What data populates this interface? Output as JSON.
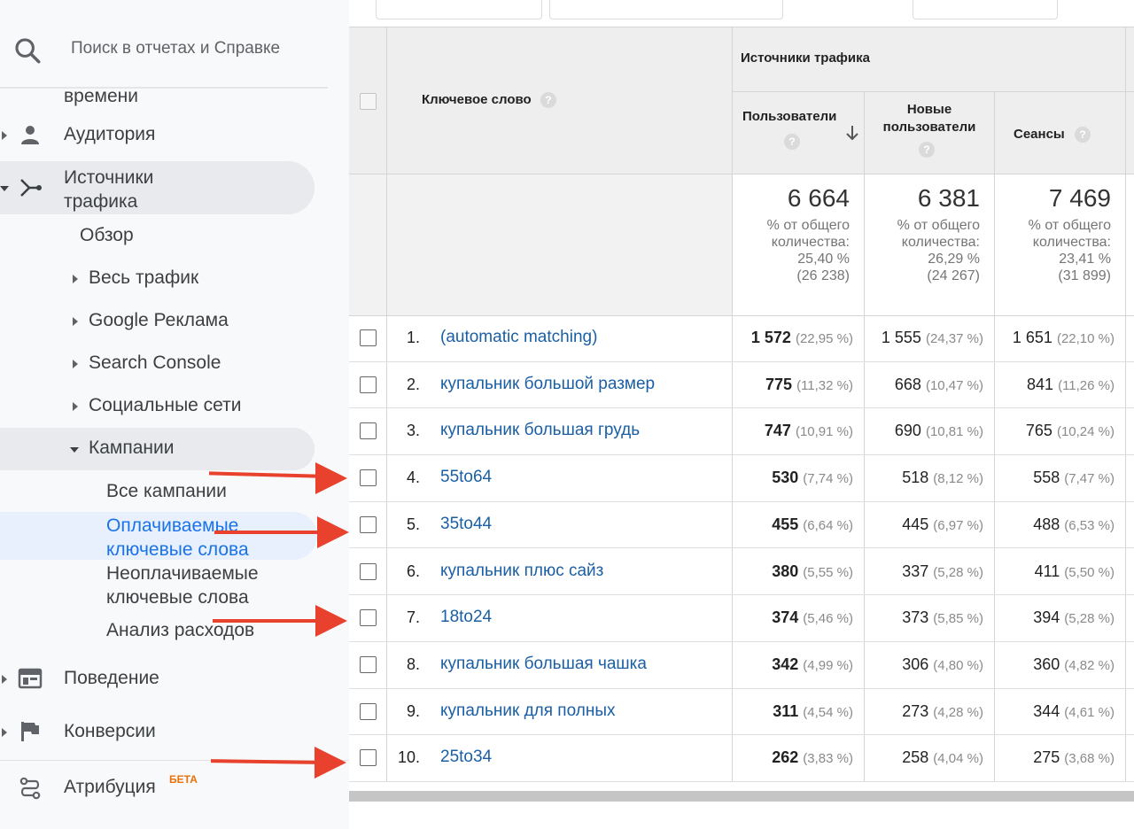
{
  "search": {
    "placeholder": "Поиск в отчетах и Справке"
  },
  "sidebar": {
    "partial_top": "времени",
    "audience": "Аудитория",
    "traffic_sources_line1": "Источники",
    "traffic_sources_line2": "трафика",
    "overview": "Обзор",
    "all_traffic": "Весь трафик",
    "google_ads": "Google Реклама",
    "search_console": "Search Console",
    "social": "Социальные сети",
    "campaigns": "Кампании",
    "all_campaigns": "Все кампании",
    "paid_keywords_line1": "Оплачиваемые",
    "paid_keywords_line2": "ключевые слова",
    "organic_keywords_line1": "Неоплачиваемые",
    "organic_keywords_line2": "ключевые слова",
    "cost_analysis": "Анализ расходов",
    "behavior": "Поведение",
    "conversions": "Конверсии",
    "attribution": "Атрибуция",
    "attribution_badge": "БЕТА"
  },
  "table": {
    "keyword_header": "Ключевое слово",
    "group_header": "Источники трафика",
    "col_users": "Пользователи",
    "col_new_users_line1": "Новые",
    "col_new_users_line2": "пользователи",
    "col_sessions": "Сеансы",
    "help_glyph": "?",
    "totals": {
      "users": "6 664",
      "new_users": "6 381",
      "sessions": "7 469",
      "caption_line1": "% от общего",
      "caption_line2": "количества:",
      "users_pct": "25,40 %",
      "users_of": "(26 238)",
      "new_users_pct": "26,29 %",
      "new_users_of": "(24 267)",
      "sessions_pct": "23,41 %",
      "sessions_of": "(31 899)"
    },
    "rows": [
      {
        "n": "1.",
        "keyword": "(automatic matching)",
        "users": "1 572",
        "users_pct": "(22,95 %)",
        "new_users": "1 555",
        "new_users_pct": "(24,37 %)",
        "sessions": "1 651",
        "sessions_pct": "(22,10 %)"
      },
      {
        "n": "2.",
        "keyword": "купальник большой размер",
        "users": "775",
        "users_pct": "(11,32 %)",
        "new_users": "668",
        "new_users_pct": "(10,47 %)",
        "sessions": "841",
        "sessions_pct": "(11,26 %)"
      },
      {
        "n": "3.",
        "keyword": "купальник большая грудь",
        "users": "747",
        "users_pct": "(10,91 %)",
        "new_users": "690",
        "new_users_pct": "(10,81 %)",
        "sessions": "765",
        "sessions_pct": "(10,24 %)"
      },
      {
        "n": "4.",
        "keyword": "55to64",
        "users": "530",
        "users_pct": "(7,74 %)",
        "new_users": "518",
        "new_users_pct": "(8,12 %)",
        "sessions": "558",
        "sessions_pct": "(7,47 %)"
      },
      {
        "n": "5.",
        "keyword": "35to44",
        "users": "455",
        "users_pct": "(6,64 %)",
        "new_users": "445",
        "new_users_pct": "(6,97 %)",
        "sessions": "488",
        "sessions_pct": "(6,53 %)"
      },
      {
        "n": "6.",
        "keyword": "купальник плюс сайз",
        "users": "380",
        "users_pct": "(5,55 %)",
        "new_users": "337",
        "new_users_pct": "(5,28 %)",
        "sessions": "411",
        "sessions_pct": "(5,50 %)"
      },
      {
        "n": "7.",
        "keyword": "18to24",
        "users": "374",
        "users_pct": "(5,46 %)",
        "new_users": "373",
        "new_users_pct": "(5,85 %)",
        "sessions": "394",
        "sessions_pct": "(5,28 %)"
      },
      {
        "n": "8.",
        "keyword": "купальник большая чашка",
        "users": "342",
        "users_pct": "(4,99 %)",
        "new_users": "306",
        "new_users_pct": "(4,80 %)",
        "sessions": "360",
        "sessions_pct": "(4,82 %)"
      },
      {
        "n": "9.",
        "keyword": "купальник для полных",
        "users": "311",
        "users_pct": "(4,54 %)",
        "new_users": "273",
        "new_users_pct": "(4,28 %)",
        "sessions": "344",
        "sessions_pct": "(4,61 %)"
      },
      {
        "n": "10.",
        "keyword": "25to34",
        "users": "262",
        "users_pct": "(3,83 %)",
        "new_users": "258",
        "new_users_pct": "(4,04 %)",
        "sessions": "275",
        "sessions_pct": "(3,68 %)"
      }
    ]
  },
  "colors": {
    "link": "#1a5fa5",
    "arrow": "#e8412d",
    "accent": "#1a73e8",
    "badge": "#e8710a"
  }
}
